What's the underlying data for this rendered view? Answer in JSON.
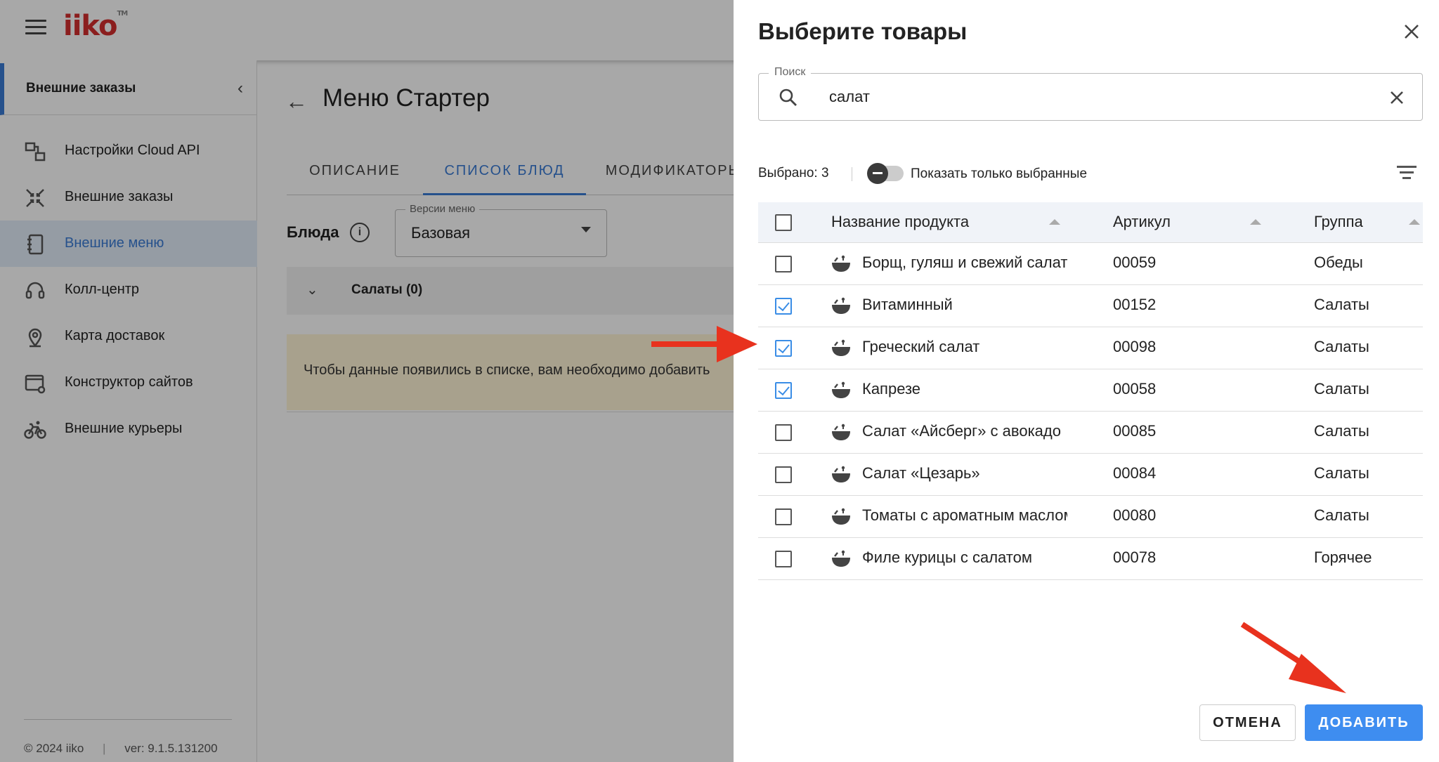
{
  "app": {
    "logo": "iiko",
    "logo_tm": "TM"
  },
  "sidebar": {
    "header": "Внешние заказы",
    "items": [
      {
        "label": "Настройки Cloud API",
        "icon": "cloud-api-icon"
      },
      {
        "label": "Внешние заказы",
        "icon": "external-orders-icon"
      },
      {
        "label": "Внешние меню",
        "icon": "external-menu-icon",
        "active": true
      },
      {
        "label": "Колл-центр",
        "icon": "headset-icon"
      },
      {
        "label": "Карта доставок",
        "icon": "map-pin-icon"
      },
      {
        "label": "Конструктор сайтов",
        "icon": "site-builder-icon"
      },
      {
        "label": "Внешние курьеры",
        "icon": "bicycle-icon"
      }
    ],
    "footer": {
      "copyright": "© 2024 iiko",
      "version": "ver: 9.1.5.131200"
    }
  },
  "main": {
    "title": "Меню Стартер",
    "tabs": [
      {
        "label": "ОПИСАНИЕ"
      },
      {
        "label": "СПИСОК БЛЮД",
        "active": true
      },
      {
        "label": "МОДИФИКАТОРЫ"
      }
    ],
    "dishes_label": "Блюда",
    "version_select": {
      "legend": "Версии меню",
      "value": "Базовая"
    },
    "group_row": "Салаты (0)",
    "notice": "Чтобы данные появились в списке, вам необходимо добавить"
  },
  "dialog": {
    "title": "Выберите товары",
    "search": {
      "legend": "Поиск",
      "value": "салат"
    },
    "selected_count": "Выбрано: 3",
    "toggle_label": "Показать только выбранные",
    "columns": {
      "name": "Название продукта",
      "article": "Артикул",
      "group": "Группа"
    },
    "rows": [
      {
        "name": "Борщ, гуляш и свежий салат",
        "article": "00059",
        "group": "Обеды",
        "checked": false
      },
      {
        "name": "Витаминный",
        "article": "00152",
        "group": "Салаты",
        "checked": true
      },
      {
        "name": "Греческий салат",
        "article": "00098",
        "group": "Салаты",
        "checked": true
      },
      {
        "name": "Капрезе",
        "article": "00058",
        "group": "Салаты",
        "checked": true
      },
      {
        "name": "Салат «Айсберг» с авокадо",
        "article": "00085",
        "group": "Салаты",
        "checked": false
      },
      {
        "name": "Салат «Цезарь»",
        "article": "00084",
        "group": "Салаты",
        "checked": false
      },
      {
        "name": "Томаты с ароматным маслом",
        "article": "00080",
        "group": "Салаты",
        "checked": false
      },
      {
        "name": "Филе курицы с салатом",
        "article": "00078",
        "group": "Горячее",
        "checked": false
      }
    ],
    "cancel_label": "ОТМЕНА",
    "add_label": "ДОБАВИТЬ"
  },
  "colors": {
    "accent": "#3a7bd5",
    "add_button": "#3e8df0",
    "annotation_arrow": "#e8321e",
    "notice_bg": "#fff4d6"
  }
}
